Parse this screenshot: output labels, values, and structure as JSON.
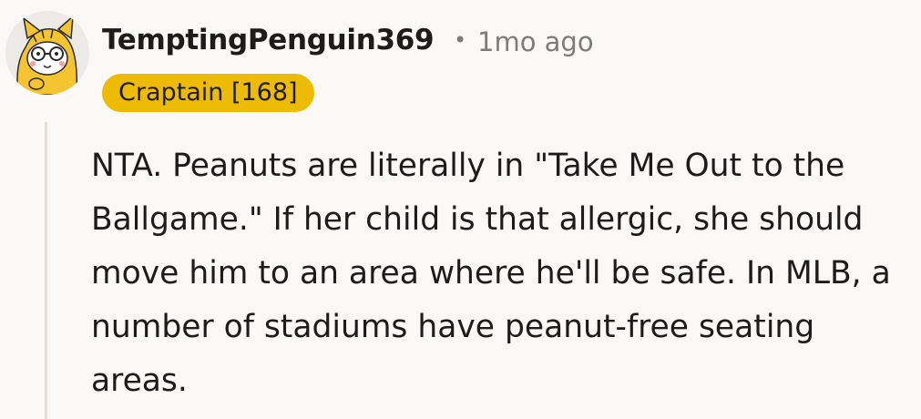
{
  "comment": {
    "author": "TemptingPenguin369",
    "separator": "•",
    "timestamp": "1mo ago",
    "flair": "Craptain [168]",
    "body": "NTA. Peanuts are literally in \"Take Me Out to the Ballgame.\" If her child is that allergic, she should move him to an area where he'll be safe. In MLB, a number of stadiums have peanut-free seating areas.",
    "avatar_icon": "snoo-avatar-icon"
  },
  "colors": {
    "background": "#fbf9f7",
    "flair_background": "#edba04",
    "text": "#1c1c1c",
    "meta_text": "#7c7c7c",
    "thread_line": "#e6ddd5"
  }
}
